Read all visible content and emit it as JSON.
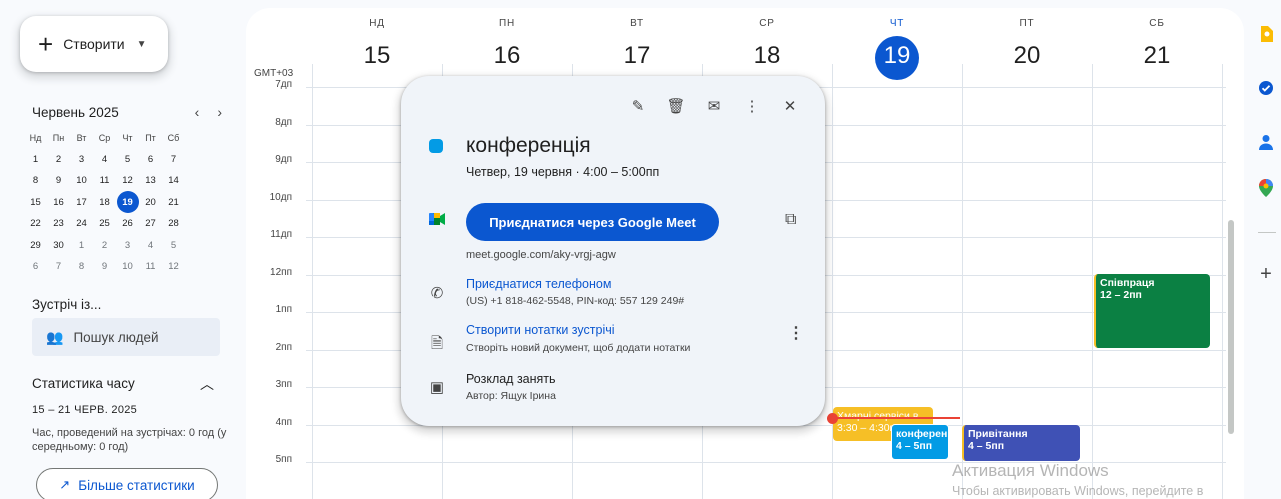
{
  "sidebar": {
    "create_label": "Створити",
    "mini_calendar": {
      "month": "Червень 2025",
      "weekdays": [
        "Нд",
        "Пн",
        "Вт",
        "Ср",
        "Чт",
        "Пт",
        "Сб"
      ],
      "weeks": [
        [
          "1",
          "2",
          "3",
          "4",
          "5",
          "6",
          "7"
        ],
        [
          "8",
          "9",
          "10",
          "11",
          "12",
          "13",
          "14"
        ],
        [
          "15",
          "16",
          "17",
          "18",
          "19",
          "20",
          "21"
        ],
        [
          "22",
          "23",
          "24",
          "25",
          "26",
          "27",
          "28"
        ],
        [
          "29",
          "30",
          "1",
          "2",
          "3",
          "4",
          "5"
        ],
        [
          "6",
          "7",
          "8",
          "9",
          "10",
          "11",
          "12"
        ]
      ],
      "today": "19"
    },
    "meet_with": "Зустріч із...",
    "people_search_placeholder": "Пошук людей",
    "stats": {
      "title": "Статистика часу",
      "range": "15 – 21 ЧЕРВ. 2025",
      "desc": "Час, проведений на зустрічах: 0 год (у середньому: 0 год)",
      "more_button": "Більше статистики"
    }
  },
  "calendar": {
    "timezone": "GMT+03",
    "days": [
      {
        "dow": "НД",
        "num": "15"
      },
      {
        "dow": "ПН",
        "num": "16"
      },
      {
        "dow": "ВТ",
        "num": "17"
      },
      {
        "dow": "СР",
        "num": "18"
      },
      {
        "dow": "ЧТ",
        "num": "19",
        "today": true
      },
      {
        "dow": "ПТ",
        "num": "20"
      },
      {
        "dow": "СБ",
        "num": "21"
      }
    ],
    "hours": [
      "7дп",
      "8дп",
      "9дп",
      "10дп",
      "11дп",
      "12пп",
      "1пп",
      "2пп",
      "3пп",
      "4пп",
      "5пп"
    ],
    "events": [
      {
        "title": "Співпраця",
        "time": "12 – 2пп",
        "color": "#0b8043"
      },
      {
        "title": "Хмарні сервіси в",
        "time": "3:30 – 4:30пп",
        "color": "#f6bf26"
      },
      {
        "title": "конференція",
        "time": "4 – 5пп",
        "color": "#039be5"
      },
      {
        "title": "Привітання",
        "time": "4 – 5пп",
        "color": "#3f51b5"
      }
    ]
  },
  "popover": {
    "title": "конференція",
    "when": "Четвер, 19 червня  ·  4:00 – 5:00пп",
    "join_button": "Приєднатися через Google Meet",
    "meet_url": "meet.google.com/aky-vrgj-agw",
    "phone_link": "Приєднатися телефоном",
    "phone_details": "(US) +1 818-462-5548, PIN-код: 557 129 249#",
    "notes_link": "Створити нотатки зустрічі",
    "notes_desc": "Створіть новий документ, щоб додати нотатки",
    "calendar_name": "Розклад занять",
    "author": "Автор: Ящук Ірина",
    "color": "#039be5"
  },
  "watermark": {
    "line1": "Активация Windows",
    "line2": "Чтобы активировать Windows, перейдите в"
  },
  "colors": {
    "accent": "#0b57d0",
    "now_line": "#ea4335"
  }
}
